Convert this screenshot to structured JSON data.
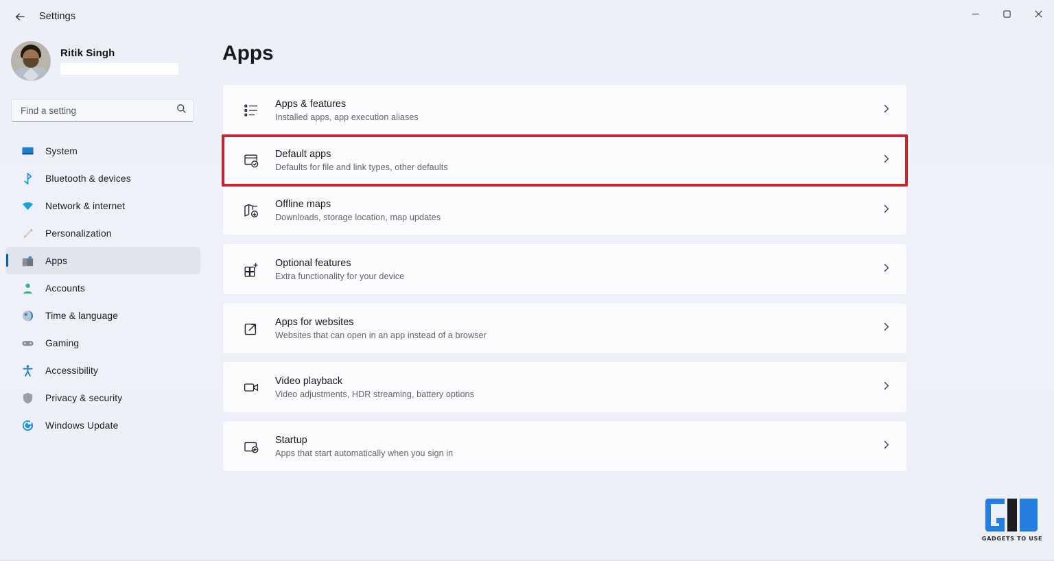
{
  "window": {
    "title": "Settings",
    "back_label": "Back",
    "controls": {
      "minimize": "Minimize",
      "maximize": "Maximize",
      "close": "Close"
    }
  },
  "account": {
    "name": "Ritik Singh",
    "email_redacted": true
  },
  "search": {
    "placeholder": "Find a setting",
    "value": "",
    "icon": "search-icon"
  },
  "sidebar": {
    "items": [
      {
        "label": "System",
        "icon": "monitor-icon",
        "active": false
      },
      {
        "label": "Bluetooth & devices",
        "icon": "bluetooth-icon",
        "active": false
      },
      {
        "label": "Network & internet",
        "icon": "wifi-icon",
        "active": false
      },
      {
        "label": "Personalization",
        "icon": "paintbrush-icon",
        "active": false
      },
      {
        "label": "Apps",
        "icon": "apps-icon",
        "active": true
      },
      {
        "label": "Accounts",
        "icon": "person-icon",
        "active": false
      },
      {
        "label": "Time & language",
        "icon": "globe-clock-icon",
        "active": false
      },
      {
        "label": "Gaming",
        "icon": "gamepad-icon",
        "active": false
      },
      {
        "label": "Accessibility",
        "icon": "accessibility-icon",
        "active": false
      },
      {
        "label": "Privacy & security",
        "icon": "shield-icon",
        "active": false
      },
      {
        "label": "Windows Update",
        "icon": "update-icon",
        "active": false
      }
    ]
  },
  "main": {
    "page_title": "Apps",
    "groups": [
      {
        "rows": [
          {
            "title": "Apps & features",
            "subtitle": "Installed apps, app execution aliases",
            "icon": "list-icon",
            "highlighted": false
          },
          {
            "title": "Default apps",
            "subtitle": "Defaults for file and link types, other defaults",
            "icon": "window-check-icon",
            "highlighted": true
          },
          {
            "title": "Offline maps",
            "subtitle": "Downloads, storage location, map updates",
            "icon": "map-download-icon",
            "highlighted": false
          }
        ]
      },
      {
        "rows": [
          {
            "title": "Optional features",
            "subtitle": "Extra functionality for your device",
            "icon": "grid-plus-icon",
            "highlighted": false
          }
        ]
      },
      {
        "rows": [
          {
            "title": "Apps for websites",
            "subtitle": "Websites that can open in an app instead of a browser",
            "icon": "external-link-icon",
            "highlighted": false
          }
        ]
      },
      {
        "rows": [
          {
            "title": "Video playback",
            "subtitle": "Video adjustments, HDR streaming, battery options",
            "icon": "video-camera-icon",
            "highlighted": false
          }
        ]
      },
      {
        "rows": [
          {
            "title": "Startup",
            "subtitle": "Apps that start automatically when you sign in",
            "icon": "startup-icon",
            "highlighted": false
          }
        ]
      }
    ],
    "chevron_icon": "chevron-right-icon"
  },
  "watermark": {
    "text": "GADGETS TO USE",
    "mark": "GU"
  },
  "colors": {
    "accent": "#0b5fb0",
    "highlight_border": "#c9252d",
    "page_background": "#eef0f9",
    "card_background": "#fbfbfd",
    "selection_background": "#e2e4ec"
  }
}
